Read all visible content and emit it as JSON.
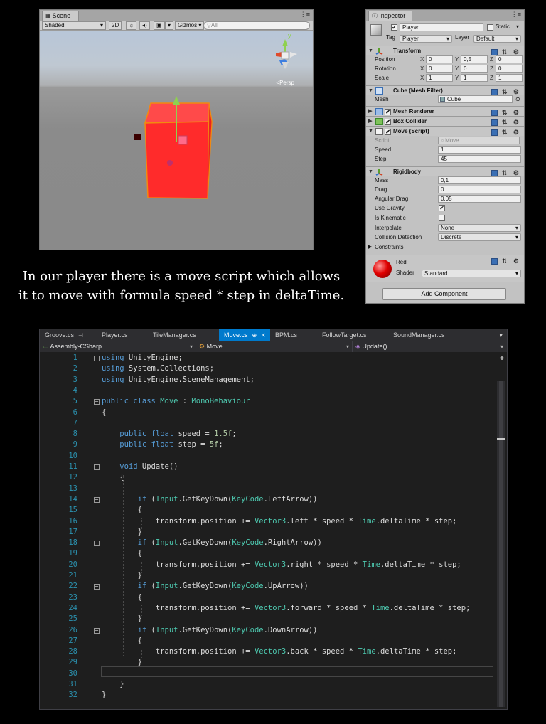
{
  "scene": {
    "tab_title": "Scene",
    "tab_menu": "⋮≡",
    "shading_mode": "Shaded",
    "btn_2d": "2D",
    "light_icon": "☼",
    "audio_icon": "◂)",
    "fx_icon": "▣",
    "fx_dropdown": "▾",
    "gizmos_label": "Gizmos ▾",
    "search_placeholder": "⚲All",
    "persp_label": "<Persp",
    "gizmo_axis_y": "y",
    "cube_color": "#ff2b2b"
  },
  "inspector": {
    "tab_title": "Inspector",
    "tab_menu": "⋮≡",
    "object_name": "Player",
    "static_label": "Static",
    "tag_label": "Tag",
    "tag_value": "Player",
    "layer_label": "Layer",
    "layer_value": "Default",
    "transform": {
      "title": "Transform",
      "position_label": "Position",
      "rotation_label": "Rotation",
      "scale_label": "Scale",
      "axes": [
        "X",
        "Y",
        "Z"
      ],
      "position": [
        "0",
        "0,5",
        "0"
      ],
      "rotation": [
        "0",
        "0",
        "0"
      ],
      "scale": [
        "1",
        "1",
        "1"
      ]
    },
    "mesh_filter": {
      "title": "Cube (Mesh Filter)",
      "mesh_label": "Mesh",
      "mesh_value": "Cube"
    },
    "mesh_renderer": {
      "title": "Mesh Renderer"
    },
    "box_collider": {
      "title": "Box Collider"
    },
    "move_script": {
      "title": "Move (Script)",
      "script_label": "Script",
      "script_value": "Move",
      "speed_label": "Speed",
      "speed_value": "1",
      "step_label": "Step",
      "step_value": "45"
    },
    "rigidbody": {
      "title": "Rigidbody",
      "mass_label": "Mass",
      "mass_value": "0,1",
      "drag_label": "Drag",
      "drag_value": "0",
      "angular_drag_label": "Angular Drag",
      "angular_drag_value": "0,05",
      "use_gravity_label": "Use Gravity",
      "use_gravity": "✔",
      "is_kinematic_label": "Is Kinematic",
      "interpolate_label": "Interpolate",
      "interpolate_value": "None",
      "collision_label": "Collision Detection",
      "collision_value": "Discrete",
      "constraints_label": "Constraints"
    },
    "material": {
      "name": "Red",
      "shader_label": "Shader",
      "shader_value": "Standard"
    },
    "add_component": "Add Component"
  },
  "caption": {
    "line1": "In our player there is a move script which allows",
    "line2": "it to move with formula speed * step in deltaTime."
  },
  "editor": {
    "tabs": [
      "Groove.cs",
      "Player.cs",
      "TileManager.cs",
      "Move.cs",
      "BPM.cs",
      "FollowTarget.cs",
      "SoundManager.cs"
    ],
    "active_tab": "Move.cs",
    "tab_pin": "⊕",
    "tab_close": "✕",
    "nav_project": "Assembly-CSharp",
    "nav_class": "Move",
    "nav_member": "Update()",
    "line_numbers": [
      "1",
      "2",
      "3",
      "4",
      "5",
      "6",
      "7",
      "8",
      "9",
      "10",
      "11",
      "12",
      "13",
      "14",
      "15",
      "16",
      "17",
      "18",
      "19",
      "20",
      "21",
      "22",
      "23",
      "24",
      "25",
      "26",
      "27",
      "28",
      "29",
      "30",
      "31",
      "32"
    ]
  },
  "colors": {
    "keyword": "#569cd6",
    "type": "#4ec9b0",
    "number": "#b5cea8",
    "line_number": "#2b91af",
    "active_tab": "#007acc"
  }
}
